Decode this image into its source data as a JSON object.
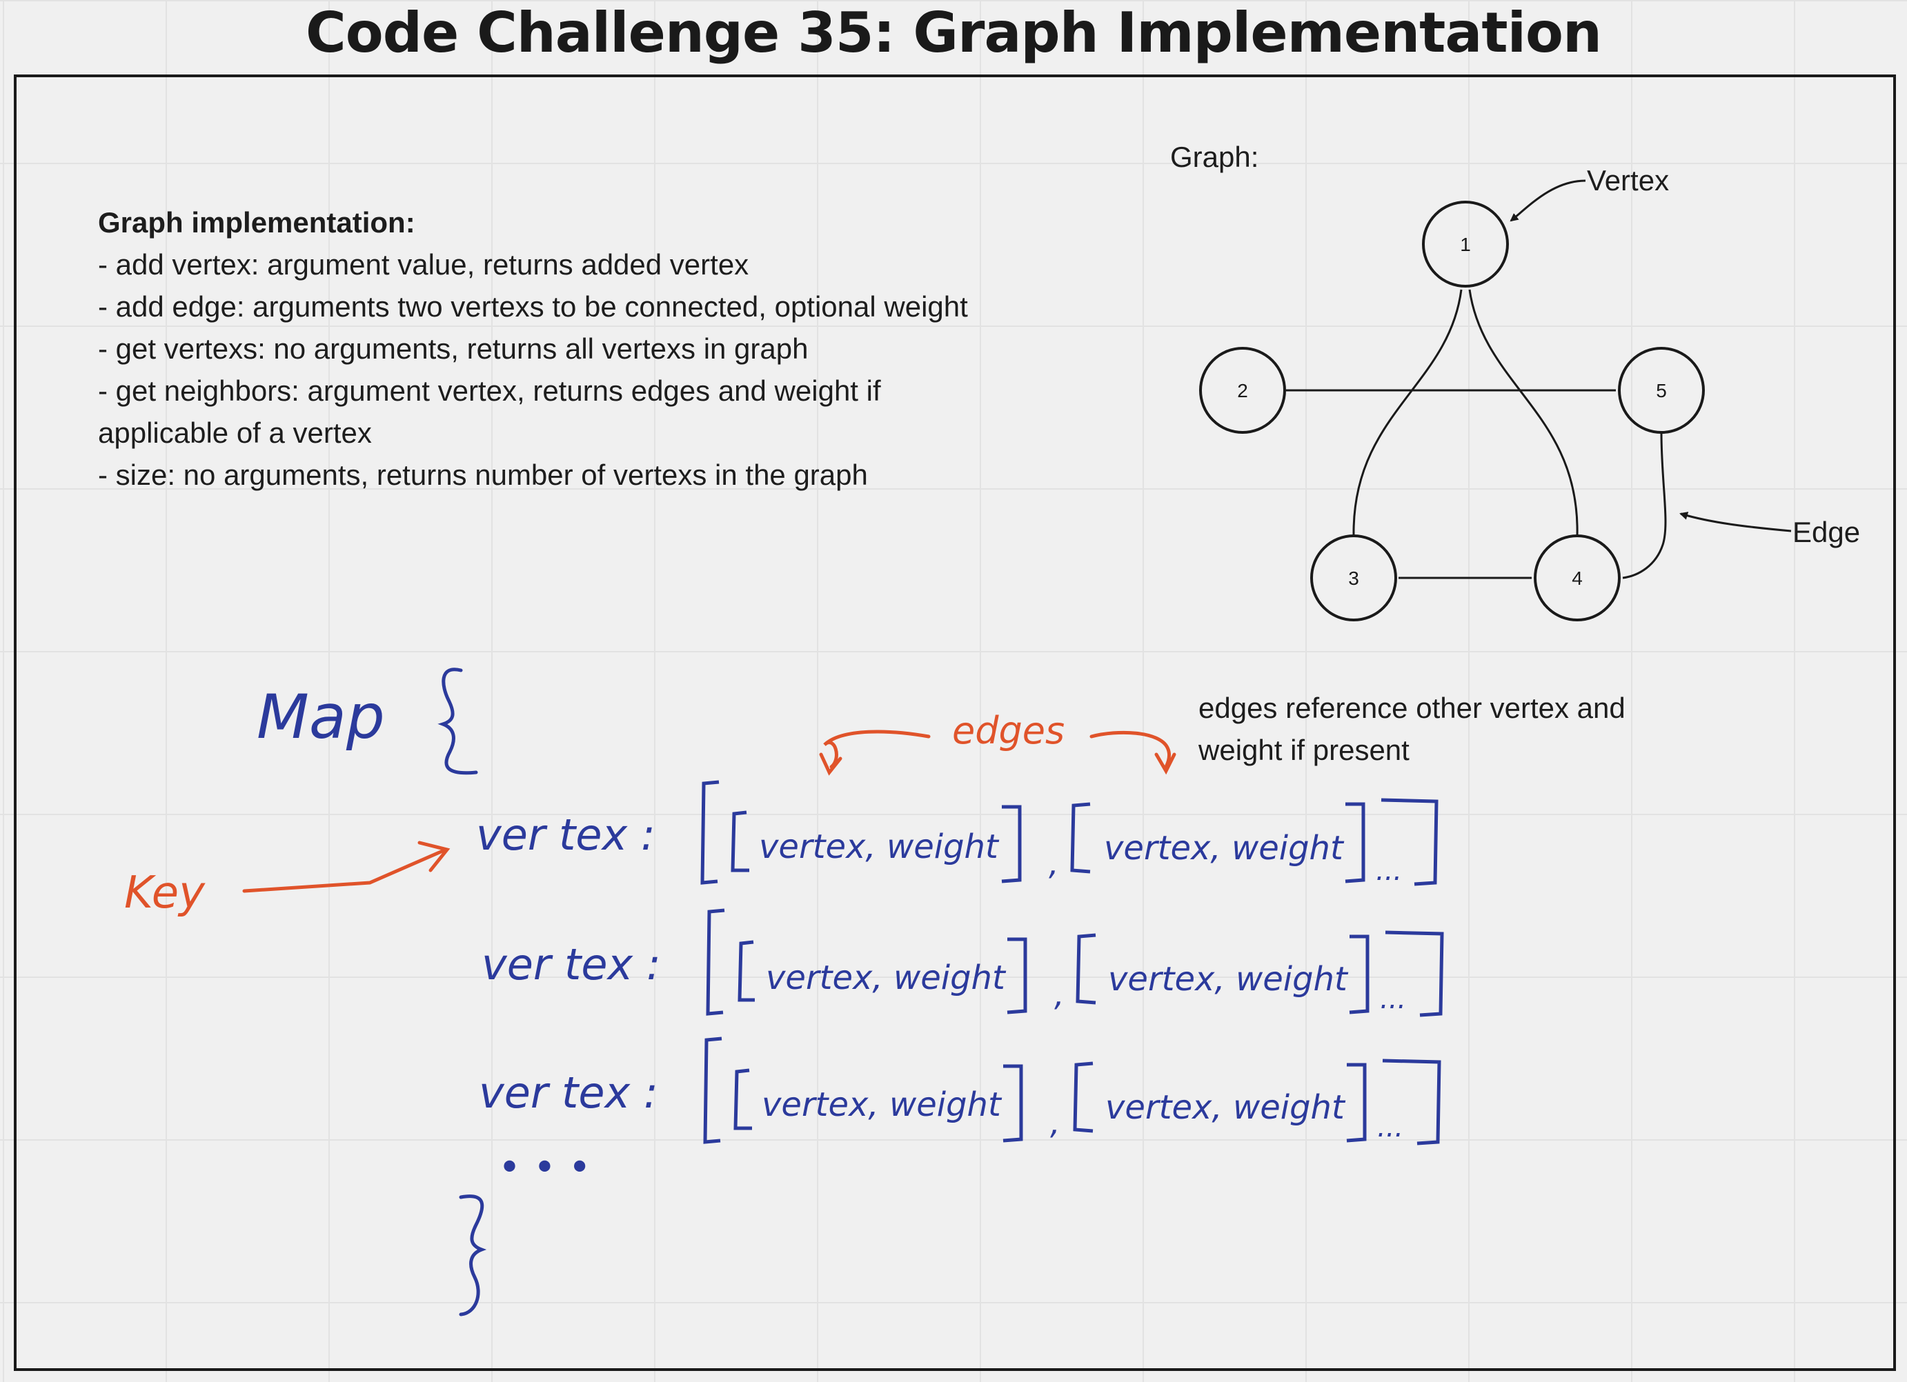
{
  "title": "Code Challenge 35: Graph Implementation",
  "spec": {
    "heading": "Graph implementation:",
    "lines": [
      "- add vertex: argument value, returns added vertex",
      "- add edge: arguments two vertexs to be connected, optional weight",
      "- get vertexs: no arguments, returns all vertexs in graph",
      "- get neighbors: argument vertex, returns edges and weight if applicable of a vertex",
      "- size: no arguments, returns number of vertexs in the graph"
    ]
  },
  "graph": {
    "label": "Graph:",
    "nodes": [
      "1",
      "2",
      "3",
      "4",
      "5"
    ],
    "vertex_callout": "Vertex",
    "edge_callout": "Edge"
  },
  "note": "edges reference other vertex and weight if present",
  "sketch": {
    "map_label": "Map",
    "key_label": "Key",
    "edges_label": "edges",
    "row_key": "ver tex :",
    "pair": "vertex, weight",
    "continuation": "...",
    "more_rows": "• • •"
  },
  "colors": {
    "ink_blue": "#2b3a9c",
    "ink_red": "#e0532a",
    "ink_black": "#1a1a1a"
  }
}
